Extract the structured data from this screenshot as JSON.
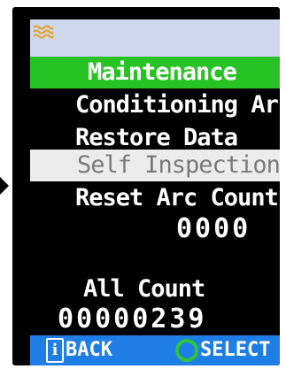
{
  "menu": {
    "header": "Maintenance",
    "items": [
      {
        "label": "Conditioning Arc",
        "selected": false
      },
      {
        "label": "Restore Data",
        "selected": false
      },
      {
        "label": "Self Inspection",
        "selected": true
      },
      {
        "label": "Reset Arc Count",
        "selected": false
      }
    ]
  },
  "arc_count": {
    "value": "0000"
  },
  "all_count": {
    "label": "All Count",
    "value": "00000239"
  },
  "footer": {
    "back_label": "BACK",
    "back_icon": "info-icon",
    "select_label": "SELECT",
    "select_icon": "circle-icon"
  },
  "colors": {
    "header_bg": "#27c223",
    "selection_bg": "#ececec",
    "footer_bg": "#1f7ee6",
    "titlebar_bg": "#cfd7ef"
  }
}
